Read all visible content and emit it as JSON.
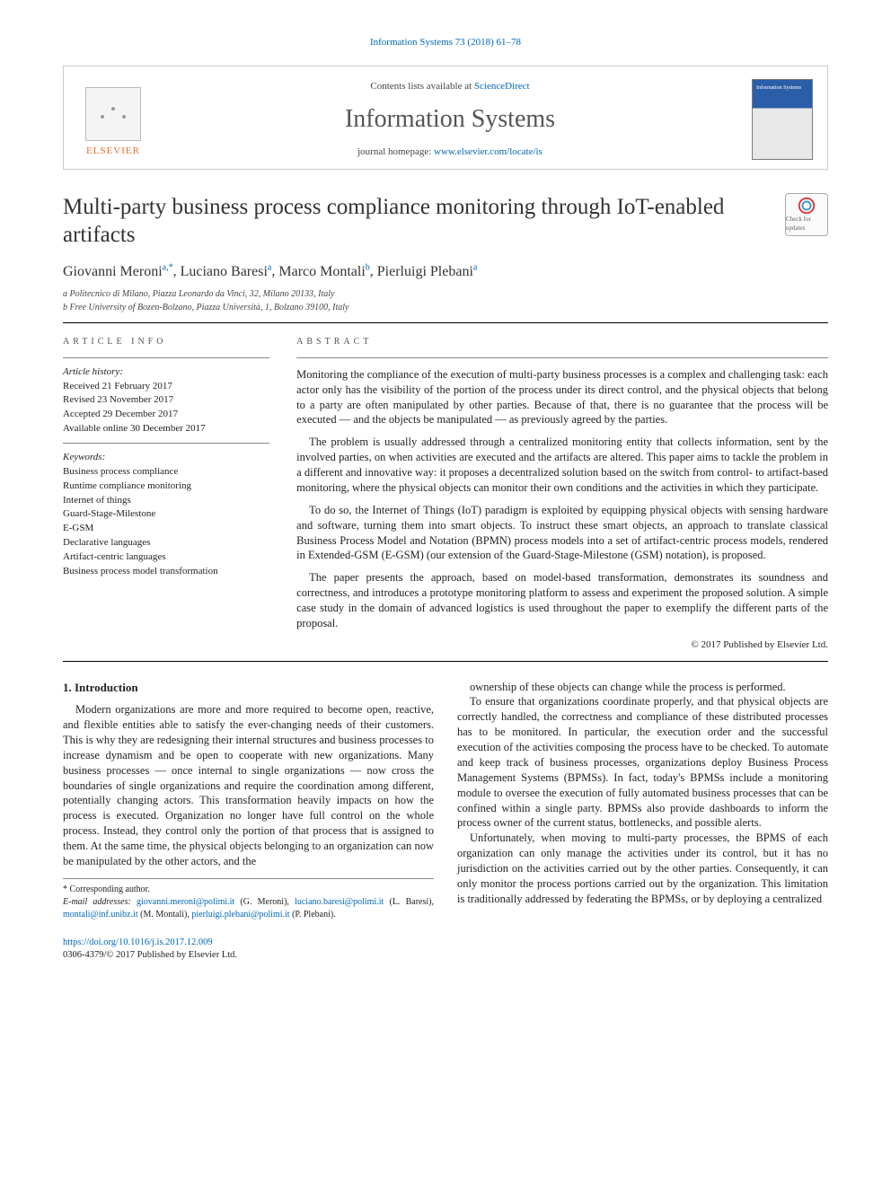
{
  "journal_ref": "Information Systems 73 (2018) 61–78",
  "masthead": {
    "contents_prefix": "Contents lists available at ",
    "contents_link": "ScienceDirect",
    "journal_name": "Information Systems",
    "homepage_prefix": "journal homepage: ",
    "homepage_url": "www.elsevier.com/locate/is",
    "publisher": "ELSEVIER"
  },
  "crossmark": "Check for updates",
  "title": "Multi-party business process compliance monitoring through IoT-enabled artifacts",
  "authors_html": "Giovanni Meroni|a,*|, Luciano Baresi|a|, Marco Montali|b|, Pierluigi Plebani|a|",
  "authors": [
    {
      "name": "Giovanni Meroni",
      "marks": "a,*"
    },
    {
      "name": "Luciano Baresi",
      "marks": "a"
    },
    {
      "name": "Marco Montali",
      "marks": "b"
    },
    {
      "name": "Pierluigi Plebani",
      "marks": "a"
    }
  ],
  "affiliations": [
    "a Politecnico di Milano, Piazza Leonardo da Vinci, 32, Milano 20133, Italy",
    "b Free University of Bozen-Bolzano, Piazza Università, 1, Bolzano 39100, Italy"
  ],
  "info_label": "article info",
  "abstract_label": "abstract",
  "history_head": "Article history:",
  "history": [
    "Received 21 February 2017",
    "Revised 23 November 2017",
    "Accepted 29 December 2017",
    "Available online 30 December 2017"
  ],
  "keywords_head": "Keywords:",
  "keywords": [
    "Business process compliance",
    "Runtime compliance monitoring",
    "Internet of things",
    "Guard-Stage-Milestone",
    "E-GSM",
    "Declarative languages",
    "Artifact-centric languages",
    "Business process model transformation"
  ],
  "abstract": [
    "Monitoring the compliance of the execution of multi-party business processes is a complex and challenging task: each actor only has the visibility of the portion of the process under its direct control, and the physical objects that belong to a party are often manipulated by other parties. Because of that, there is no guarantee that the process will be executed — and the objects be manipulated — as previously agreed by the parties.",
    "The problem is usually addressed through a centralized monitoring entity that collects information, sent by the involved parties, on when activities are executed and the artifacts are altered. This paper aims to tackle the problem in a different and innovative way: it proposes a decentralized solution based on the switch from control- to artifact-based monitoring, where the physical objects can monitor their own conditions and the activities in which they participate.",
    "To do so, the Internet of Things (IoT) paradigm is exploited by equipping physical objects with sensing hardware and software, turning them into smart objects. To instruct these smart objects, an approach to translate classical Business Process Model and Notation (BPMN) process models into a set of artifact-centric process models, rendered in Extended-GSM (E-GSM) (our extension of the Guard-Stage-Milestone (GSM) notation), is proposed.",
    "The paper presents the approach, based on model-based transformation, demonstrates its soundness and correctness, and introduces a prototype monitoring platform to assess and experiment the proposed solution. A simple case study in the domain of advanced logistics is used throughout the paper to exemplify the different parts of the proposal."
  ],
  "copyright": "© 2017 Published by Elsevier Ltd.",
  "section1_head": "1. Introduction",
  "body": [
    "Modern organizations are more and more required to become open, reactive, and flexible entities able to satisfy the ever-changing needs of their customers. This is why they are redesigning their internal structures and business processes to increase dynamism and be open to cooperate with new organizations. Many business processes — once internal to single organizations — now cross the boundaries of single organizations and require the coordination among different, potentially changing actors. This transformation heavily impacts on how the process is executed. Organization no longer have full control on the whole process. Instead, they control only the portion of that process that is assigned to them. At the same time, the physical objects belonging to an organization can now be manipulated by the other actors, and the",
    "ownership of these objects can change while the process is performed.",
    "To ensure that organizations coordinate properly, and that physical objects are correctly handled, the correctness and compliance of these distributed processes has to be monitored. In particular, the execution order and the successful execution of the activities composing the process have to be checked. To automate and keep track of business processes, organizations deploy Business Process Management Systems (BPMSs). In fact, today's BPMSs include a monitoring module to oversee the execution of fully automated business processes that can be confined within a single party. BPMSs also provide dashboards to inform the process owner of the current status, bottlenecks, and possible alerts.",
    "Unfortunately, when moving to multi-party processes, the BPMS of each organization can only manage the activities under its control, but it has no jurisdiction on the activities carried out by the other parties. Consequently, it can only monitor the process portions carried out by the organization. This limitation is traditionally addressed by federating the BPMSs, or by deploying a centralized"
  ],
  "footnote_corr": "* Corresponding author.",
  "footnote_email_label": "E-mail addresses:",
  "emails": [
    {
      "addr": "giovanni.meroni@polimi.it",
      "who": "(G. Meroni)"
    },
    {
      "addr": "luciano.baresi@polimi.it",
      "who": "(L. Baresi)"
    },
    {
      "addr": "montali@inf.unibz.it",
      "who": "(M. Montali)"
    },
    {
      "addr": "pierluigi.plebani@polimi.it",
      "who": "(P. Plebani)"
    }
  ],
  "doi": "https://doi.org/10.1016/j.is.2017.12.009",
  "issn_line": "0306-4379/© 2017 Published by Elsevier Ltd."
}
